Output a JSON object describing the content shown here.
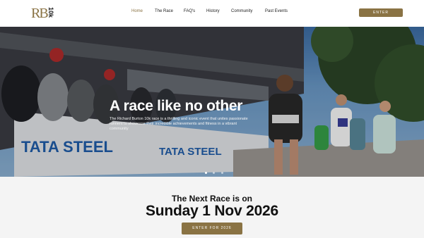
{
  "brand": {
    "logo_letters": "RB",
    "logo_suffix": "10k"
  },
  "nav": {
    "items": [
      {
        "label": "Home",
        "active": true
      },
      {
        "label": "The Race",
        "active": false
      },
      {
        "label": "FAQ's",
        "active": false
      },
      {
        "label": "History",
        "active": false
      },
      {
        "label": "Community",
        "active": false
      },
      {
        "label": "Past Events",
        "active": false
      }
    ],
    "enter_label": "ENTER"
  },
  "hero": {
    "title": "A race like no other",
    "description": "The Richard Burton 10k race is a thrilling and iconic event that unites passionate runners to showcase their incredible achievements and fitness in a vibrant community",
    "banner_text_1": "TATA STEEL",
    "banner_text_2": "TATA STEEL",
    "slides": 3,
    "active_slide": 1
  },
  "next_race": {
    "label": "The Next Race is on",
    "date": "Sunday 1 Nov 2026",
    "button_label": "ENTER FOR 2026"
  },
  "colors": {
    "accent": "#8a7344",
    "banner_blue": "#1f5fae"
  }
}
